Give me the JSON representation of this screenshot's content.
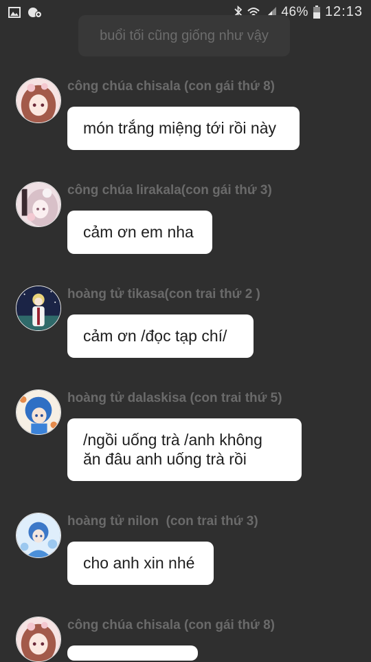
{
  "status_bar": {
    "left_icons": [
      "image-icon",
      "cloud-sync-icon"
    ],
    "right_icons": [
      "bluetooth-icon",
      "wifi-icon",
      "signal-icon",
      "battery-icon"
    ],
    "battery_percent": "46%",
    "time": "12:13"
  },
  "narration": {
    "text": "buổi tối cũng giống như vậy"
  },
  "messages": [
    {
      "sender": "công chúa chisala (con gái thứ 8)",
      "text": "món trắng miệng tới rồi này",
      "avatar": "pink-hair-princess-avatar"
    },
    {
      "sender": "công chúa lirakala(con gái thứ 3)",
      "text": "cảm ơn em nha",
      "avatar": "white-flower-princess-avatar"
    },
    {
      "sender": "hoàng tử tikasa(con trai thứ 2 )",
      "text": "cảm ơn /đọc tạp chí/",
      "avatar": "blond-prince-night-avatar"
    },
    {
      "sender": "hoàng tử dalaskisa (con trai thứ 5)",
      "text": "/ngồi uống trà /anh không\năn đâu anh uống trà rồi",
      "avatar": "blue-hair-prince-avatar"
    },
    {
      "sender": "hoàng tử nilon  (con trai thứ 3)",
      "text": "cho anh xin nhé",
      "avatar": "blue-water-prince-avatar"
    },
    {
      "sender": "công chúa chisala (con gái thứ 8)",
      "text": "",
      "avatar": "pink-hair-princess-avatar"
    }
  ],
  "colors": {
    "background": "#2f2f2f",
    "bubble": "#ffffff",
    "sender_text": "#6a6a6a",
    "narration_bg": "#383838",
    "narration_text": "#6c6c6c"
  }
}
